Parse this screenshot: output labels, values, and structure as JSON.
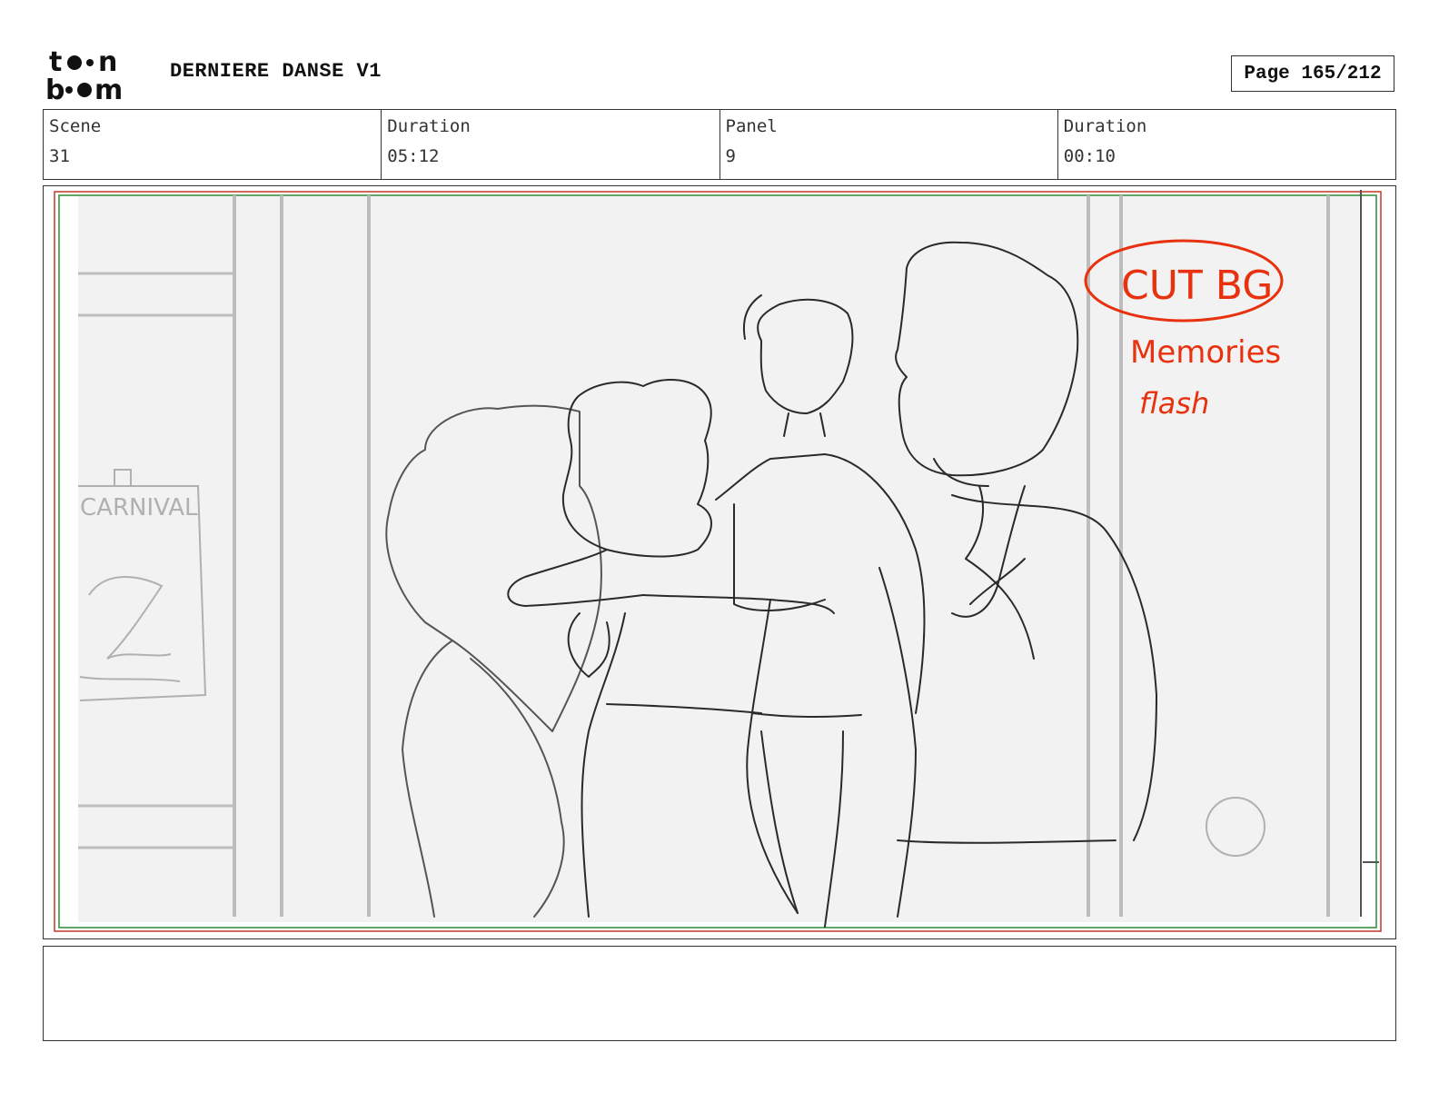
{
  "header": {
    "logo_icon": "toon-boom-logo",
    "title": "DERNIERE DANSE V1",
    "page_label": "Page 165/212"
  },
  "info": {
    "scene_label": "Scene",
    "scene_value": "31",
    "duration_label": "Duration",
    "duration_value": "05:12",
    "panel_label": "Panel",
    "panel_value": "9",
    "panel_duration_label": "Duration",
    "panel_duration_value": "00:10"
  },
  "panel": {
    "annotation_line1": "CUT BG",
    "annotation_line2": "Memories",
    "annotation_line3": "flash",
    "poster_text": "CARNIVAL"
  },
  "notes": {
    "text": ""
  },
  "colors": {
    "annotation": "#e8320f",
    "safe_frame_red": "#c0392b",
    "safe_frame_green": "#2e8b3a",
    "sketch_line": "#2a2a2a",
    "background_sketch": "#bdbdbd"
  }
}
